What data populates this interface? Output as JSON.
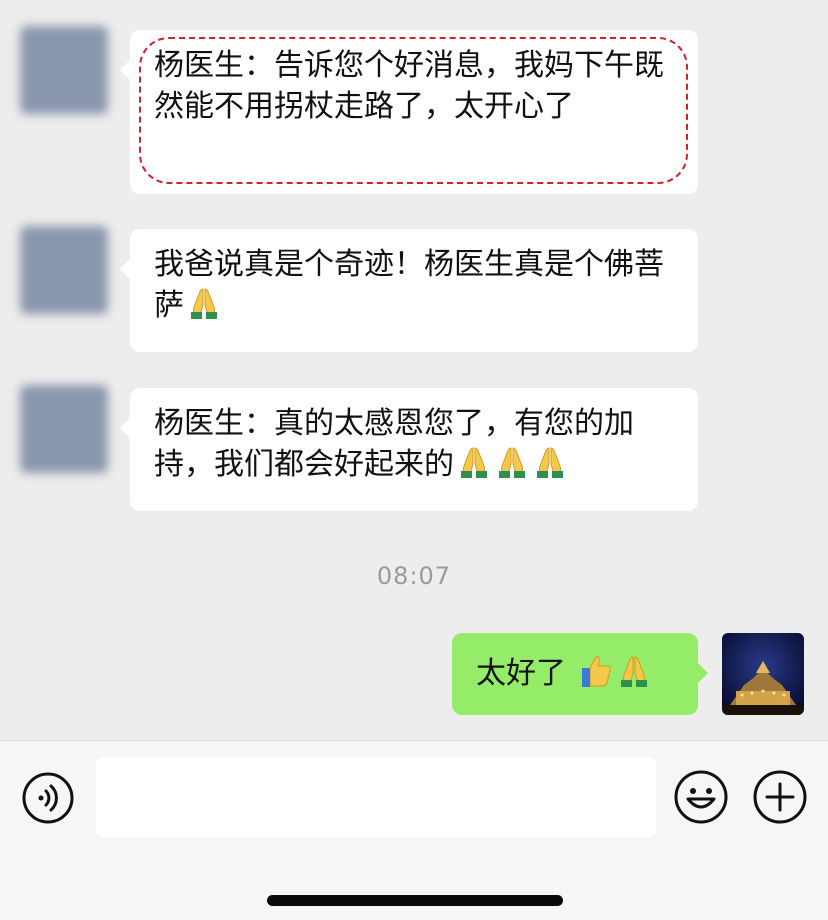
{
  "messages": [
    {
      "sender": "other",
      "text": "杨医生：告诉您个好消息，我妈下午既然能不用拐杖走路了，太开心了",
      "emojis": []
    },
    {
      "sender": "other",
      "text": "我爸说真是个奇迹！杨医生真是个佛菩萨",
      "emojis": [
        "folded-hands"
      ]
    },
    {
      "sender": "other",
      "text": "杨医生：真的太感恩您了，有您的加持，我们都会好起来的",
      "emojis": [
        "folded-hands",
        "folded-hands",
        "folded-hands"
      ]
    },
    {
      "sender": "me",
      "text": "太好了 ",
      "emojis": [
        "thumbs-up",
        "folded-hands"
      ]
    }
  ],
  "timestamp": "08:07",
  "input": {
    "placeholder": ""
  },
  "colors": {
    "background": "#ededed",
    "my_bubble": "#95ec69",
    "other_bubble": "#ffffff",
    "highlight": "#d0222a"
  },
  "icons": {
    "voice": "voice-icon",
    "emoji": "smiley-icon",
    "more": "plus-circle-icon"
  }
}
